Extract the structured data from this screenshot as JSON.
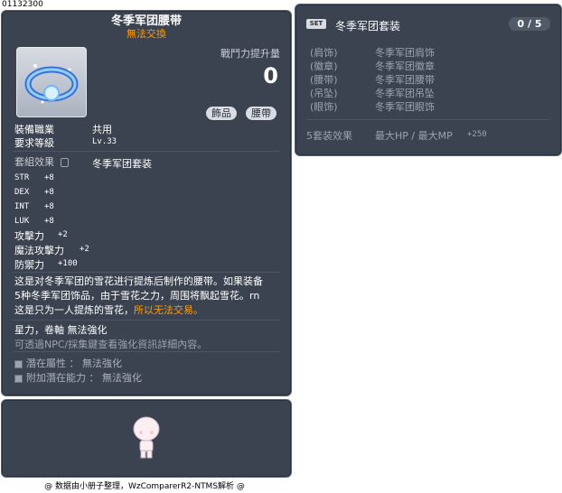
{
  "item_id": "01132300",
  "item": {
    "name": "冬季军团腰带",
    "trade_status": "無法交換",
    "combat_power_label": "戰鬥力提升量",
    "combat_power_value": "0",
    "tags": [
      "飾品",
      "腰帶"
    ],
    "job_label": "裝備職業",
    "job_value": "共用",
    "level_label": "要求等級",
    "level_value": "Lv.33",
    "set_label": "套組效果",
    "set_value": "冬季军团套装",
    "stats": [
      {
        "name": "STR",
        "value": "+8"
      },
      {
        "name": "DEX",
        "value": "+8"
      },
      {
        "name": "INT",
        "value": "+8"
      },
      {
        "name": "LUK",
        "value": "+8"
      },
      {
        "name": "攻擊力",
        "value": "+2"
      },
      {
        "name": "魔法攻擊力",
        "value": "+2"
      },
      {
        "name": "防禦力",
        "value": "+100"
      }
    ],
    "description_line1": "这是对冬季军团的雪花进行提炼后制作的腰带。如果装备",
    "description_line2": "5种冬季军团饰品，由于雪花之力，周围将飘起雪花。rn",
    "description_line3_a": "这是只为一人提炼的雪花，",
    "description_line3_b": "所以无法交易。",
    "enhance_text": "星力，卷軸 無法強化",
    "enhance_hint": "可透過NPC/採集鍵查看強化資訊詳細內容。",
    "potential": "潛在屬性 ： 無法強化",
    "additional_potential": "附加潛在能力 ： 無法強化"
  },
  "set_panel": {
    "badge": "SET",
    "name": "冬季军团套装",
    "count": "0 / 5",
    "parts": [
      {
        "slot": "(肩饰)",
        "name": "冬季军团肩饰"
      },
      {
        "slot": "(徽章)",
        "name": "冬季军团徽章"
      },
      {
        "slot": "(腰带)",
        "name": "冬季军团腰带"
      },
      {
        "slot": "(吊坠)",
        "name": "冬季军团吊坠"
      },
      {
        "slot": "(眼饰)",
        "name": "冬季军团眼饰"
      }
    ],
    "effect_label": "5套装效果",
    "effect_stat": "最大HP / 最大MP",
    "effect_value": "+250"
  },
  "footer": "@ 数据由小册子整理，WzComparerR2-NTMS解析 @"
}
